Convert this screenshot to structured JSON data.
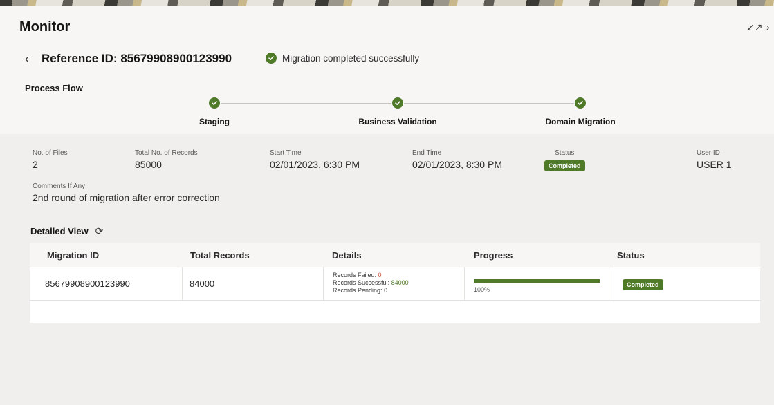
{
  "header": {
    "title": "Monitor",
    "minimize_icon": "collapse-arrows-icon",
    "close_icon": "close-icon"
  },
  "reference": {
    "label": "Reference ID: 85679908900123990",
    "status_text": "Migration completed successfully",
    "back_icon": "chevron-left-icon",
    "status_icon": "check-circle-icon"
  },
  "process_flow": {
    "title": "Process Flow",
    "steps": [
      {
        "label": "Staging",
        "state": "complete"
      },
      {
        "label": "Business Validation",
        "state": "complete"
      },
      {
        "label": "Domain Migration",
        "state": "complete"
      }
    ]
  },
  "summary": {
    "files_label": "No. of Files",
    "files_value": "2",
    "records_label": "Total No. of Records",
    "records_value": "85000",
    "start_label": "Start Time",
    "start_value": "02/01/2023, 6:30 PM",
    "end_label": "End Time",
    "end_value": "02/01/2023, 8:30 PM",
    "status_label": "Status",
    "status_value": "Completed",
    "user_label": "User ID",
    "user_value": "USER 1",
    "comments_label": "Comments If Any",
    "comments_value": "2nd round of migration after error correction"
  },
  "detailed_view": {
    "title": "Detailed View",
    "refresh_icon": "refresh-icon",
    "columns": [
      "Migration ID",
      "Total Records",
      "Details",
      "Progress",
      "Status"
    ],
    "rows": [
      {
        "migration_id": "85679908900123990",
        "total_records": "84000",
        "failed_label": "Records Failed:",
        "failed_value": "0",
        "successful_label": "Records Successful:",
        "successful_value": "84000",
        "pending_label": "Records Pending:",
        "pending_value": "0",
        "progress_text": "100%",
        "progress_fraction": 1.0,
        "status": "Completed"
      }
    ]
  },
  "colors": {
    "success": "#4f7a28",
    "failed": "#c74634",
    "text": "#161513"
  }
}
